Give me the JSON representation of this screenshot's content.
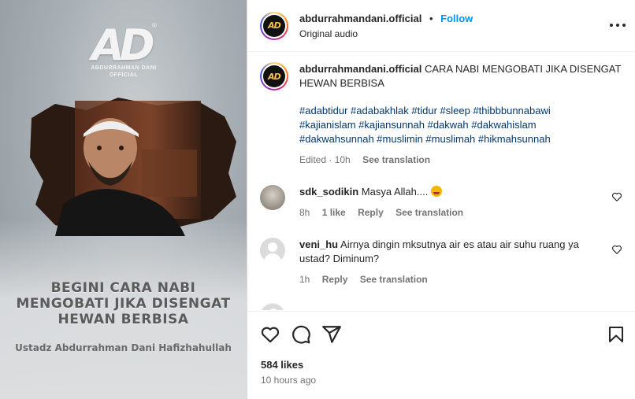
{
  "media": {
    "logo_text": "AD",
    "logo_sub": "ABDURRAHMAN DANI\nOFFICIAL",
    "headline": "BEGINI CARA NABI MENGOBATI JIKA DISENGAT HEWAN BERBISA",
    "speaker": "Ustadz Abdurrahman Dani Hafizhahullah"
  },
  "header": {
    "username": "abdurrahmandani.official",
    "separator": "•",
    "follow_label": "Follow",
    "audio": "Original audio",
    "avatar_text": "AD"
  },
  "caption": {
    "username": "abdurrahmandani.official",
    "text": "CARA NABI MENGOBATI JIKA DISENGAT HEWAN BERBISA",
    "hashtags_line1": "#adabtidur #adabakhlak #tidur #sleep #thibbbunnabawi",
    "hashtags_line2": "#kajianislam #kajiansunnah #dakwah #dakwahislam",
    "hashtags_line3": "#dakwahsunnah #muslimin #muslimah #hikmahsunnah",
    "edited": "Edited · 10h",
    "see_translation": "See translation"
  },
  "comments": [
    {
      "username": "sdk_sodikin",
      "text": "Masya Allah....",
      "time": "8h",
      "likes": "1 like",
      "reply": "Reply",
      "see_translation": "See translation"
    },
    {
      "username": "veni_hu",
      "text": "Airnya dingin mksutnya air es atau air suhu ruang ya ustad? Diminum?",
      "time": "1h",
      "reply": "Reply",
      "see_translation": "See translation"
    }
  ],
  "actions": {
    "likes": "584 likes",
    "posted": "10 hours ago"
  },
  "colors": {
    "link_blue": "#0095f6",
    "hashtag": "#00376b",
    "muted": "#737373"
  },
  "icons": [
    "heart-icon",
    "comment-icon",
    "share-icon",
    "bookmark-icon",
    "more-icon"
  ]
}
